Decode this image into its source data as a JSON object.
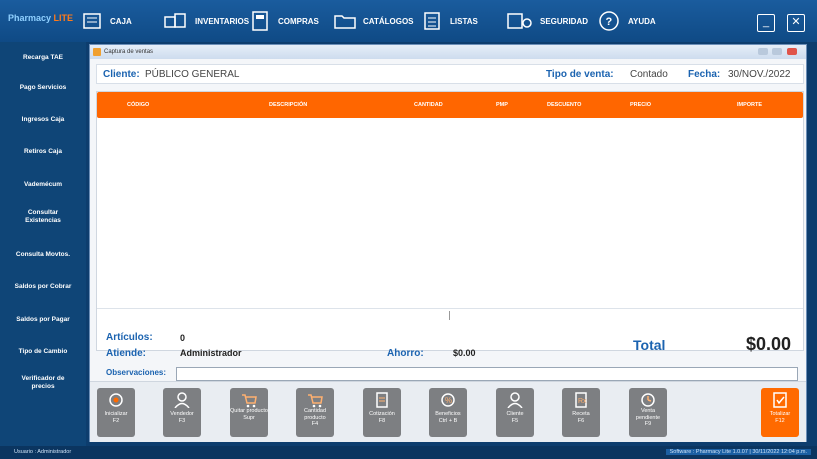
{
  "app": {
    "logo_main": "Pharmacy",
    "logo_sub": "LITE"
  },
  "topnav": [
    {
      "label": "CAJA"
    },
    {
      "label": "INVENTARIOS"
    },
    {
      "label": "COMPRAS"
    },
    {
      "label": "CATÁLOGOS"
    },
    {
      "label": "LISTAS"
    },
    {
      "label": "SEGURIDAD"
    },
    {
      "label": "AYUDA"
    }
  ],
  "sidebar": [
    {
      "label": "Recarga TAE"
    },
    {
      "label": "Pago Servicios"
    },
    {
      "label": "Ingresos Caja"
    },
    {
      "label": "Retiros Caja"
    },
    {
      "label": "Vademécum"
    },
    {
      "label": "Consultar Existencias"
    },
    {
      "label": "Consulta Movtos."
    },
    {
      "label": "Saldos por Cobrar"
    },
    {
      "label": "Saldos por Pagar"
    },
    {
      "label": "Tipo de Cambio"
    },
    {
      "label": "Verificador de precios"
    }
  ],
  "window": {
    "title": "Captura de ventas"
  },
  "info": {
    "cliente_label": "Cliente:",
    "cliente_value": "PÚBLICO GENERAL",
    "tipo_label": "Tipo de venta:",
    "tipo_value": "Contado",
    "fecha_label": "Fecha:",
    "fecha_value": "30/NOV./2022"
  },
  "grid": {
    "columns": [
      "CÓDIGO",
      "DESCRIPCIÓN",
      "CANTIDAD",
      "PMP",
      "DESCUENTO",
      "PRECIO",
      "IMPORTE"
    ]
  },
  "summary": {
    "articulos_label": "Artículos:",
    "articulos_value": "0",
    "atiende_label": "Atiende:",
    "atiende_value": "Administrador",
    "ahorro_label": "Ahorro:",
    "ahorro_value": "$0.00",
    "total_label": "Total",
    "total_value": "$0.00",
    "observaciones_label": "Observaciones:"
  },
  "toolbar": [
    {
      "line1": "Inicializar",
      "line2": "F2",
      "icon": "refresh-icon"
    },
    {
      "line1": "Vendedor",
      "line2": "F3",
      "icon": "user-icon"
    },
    {
      "line1": "Quitar producto",
      "line2": "Supr",
      "icon": "cart-remove-icon"
    },
    {
      "line1": "Cantidad producto",
      "line2": "F4",
      "icon": "cart-qty-icon"
    },
    {
      "line1": "Cotización",
      "line2": "F8",
      "icon": "document-icon"
    },
    {
      "line1": "Beneficios",
      "line2": "Ctrl + B",
      "icon": "gift-icon"
    },
    {
      "line1": "Cliente",
      "line2": "F5",
      "icon": "client-icon"
    },
    {
      "line1": "Receta",
      "line2": "F6",
      "icon": "prescription-icon"
    },
    {
      "line1": "Venta pendiente",
      "line2": "F9",
      "icon": "clock-icon"
    },
    {
      "line1": "Totalizar",
      "line2": "F12",
      "icon": "total-icon"
    }
  ],
  "status": {
    "user": "Usuario : Administrador",
    "right": "Software : Pharmacy Lite 1.0.07  |  30/11/2022 12:04 p.m."
  }
}
